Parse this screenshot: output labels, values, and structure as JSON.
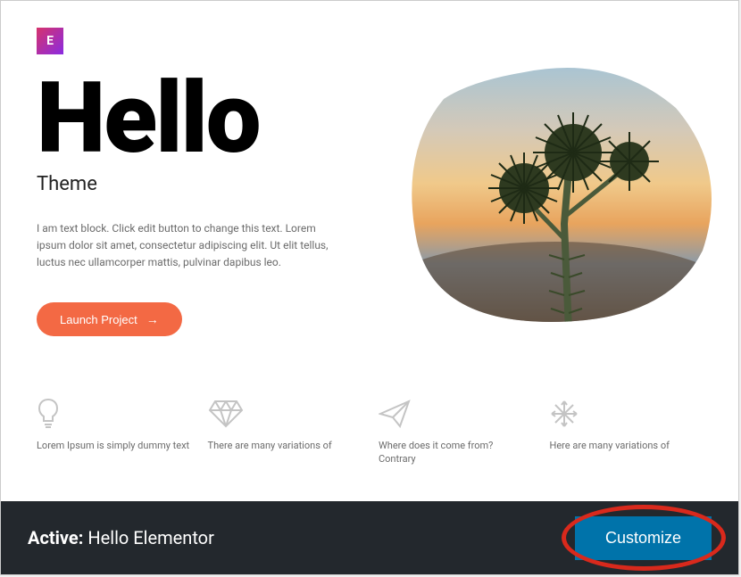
{
  "logo": {
    "text": "E"
  },
  "hero": {
    "title": "Hello",
    "subtitle": "Theme",
    "description": "I am text block. Click edit button to change this text. Lorem ipsum dolor sit amet, consectetur adipiscing elit. Ut elit tellus, luctus nec ullamcorper mattis, pulvinar dapibus leo.",
    "button_label": "Launch Project"
  },
  "features": [
    {
      "icon": "bulb-icon",
      "text": "Lorem Ipsum is simply dummy text"
    },
    {
      "icon": "diamond-icon",
      "text": "There are many variations of"
    },
    {
      "icon": "paper-plane-icon",
      "text": "Where does it come from? Contrary"
    },
    {
      "icon": "snowflake-icon",
      "text": "Here are many variations of"
    }
  ],
  "footer": {
    "active_label": "Active:",
    "theme_name": "Hello Elementor",
    "customize_label": "Customize"
  }
}
